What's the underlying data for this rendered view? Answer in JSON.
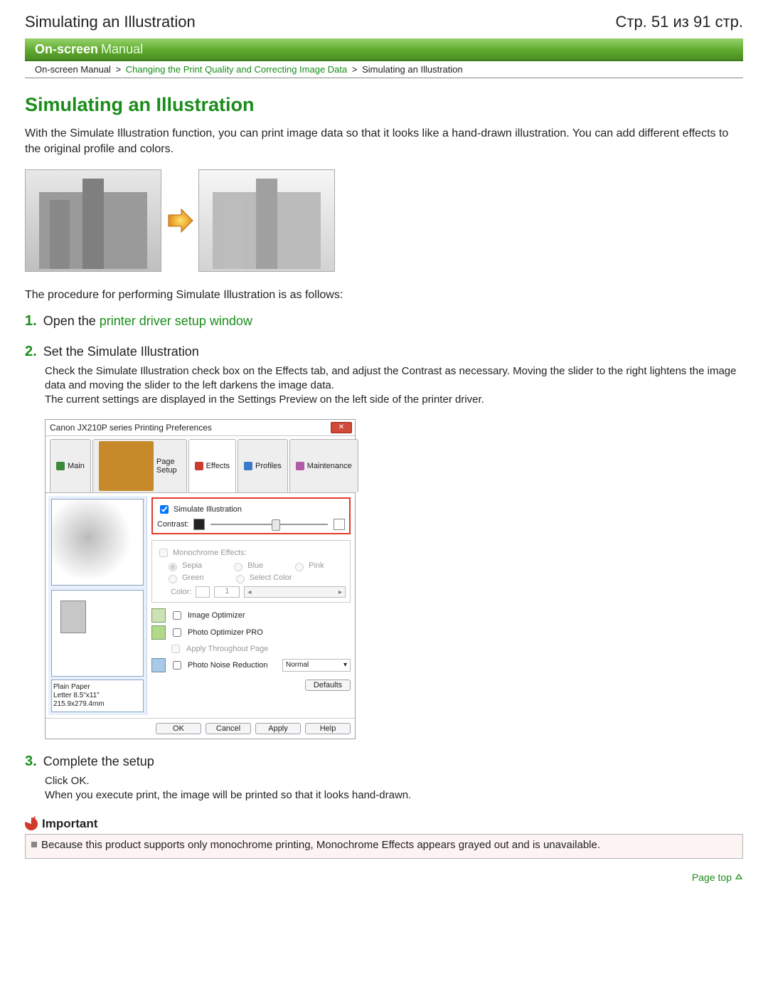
{
  "header": {
    "doc_title": "Simulating an Illustration",
    "page_indicator": "Стр. 51 из 91 стр."
  },
  "banner": {
    "bold": "On-screen",
    "light": "Manual"
  },
  "breadcrumb": {
    "root": "On-screen Manual",
    "mid": "Changing the Print Quality and Correcting Image Data",
    "leaf": "Simulating an Illustration",
    "sep": ">"
  },
  "title": "Simulating an Illustration",
  "intro": "With the Simulate Illustration function, you can print image data so that it looks like a hand-drawn illustration. You can add different effects to the original profile and colors.",
  "procedure_lead": "The procedure for performing Simulate Illustration is as follows:",
  "steps": {
    "s1": {
      "num": "1.",
      "pre": "Open the ",
      "link": "printer driver setup window"
    },
    "s2": {
      "num": "2.",
      "title": "Set the Simulate Illustration",
      "p1": "Check the Simulate Illustration check box on the Effects tab, and adjust the Contrast as necessary. Moving the slider to the right lightens the image data and moving the slider to the left darkens the image data.",
      "p2": "The current settings are displayed in the Settings Preview on the left side of the printer driver."
    },
    "s3": {
      "num": "3.",
      "title": "Complete the setup",
      "p1": "Click OK.",
      "p2": "When you execute print, the image will be printed so that it looks hand-drawn."
    }
  },
  "dialog": {
    "title": "Canon JX210P series Printing Preferences",
    "tabs": {
      "main": "Main",
      "page": "Page Setup",
      "effects": "Effects",
      "profiles": "Profiles",
      "maint": "Maintenance"
    },
    "left": {
      "paper_type": "Plain Paper",
      "paper_size": "Letter 8.5\"x11\" 215.9x279.4mm"
    },
    "sim": {
      "label": "Simulate Illustration",
      "contrast": "Contrast:"
    },
    "mono": {
      "group": "Monochrome Effects:",
      "sepia": "Sepia",
      "blue": "Blue",
      "pink": "Pink",
      "green": "Green",
      "select": "Select Color",
      "color_lbl": "Color:",
      "num": "1"
    },
    "opt": {
      "img": "Image Optimizer",
      "pro": "Photo Optimizer PRO",
      "apply": "Apply Throughout Page",
      "noise": "Photo Noise Reduction",
      "noise_val": "Normal"
    },
    "defaults": "Defaults",
    "buttons": {
      "ok": "OK",
      "cancel": "Cancel",
      "apply": "Apply",
      "help": "Help"
    },
    "scroll_left": "◄",
    "scroll_right": "►",
    "dropdown": "▾",
    "close": "✕"
  },
  "important": {
    "heading": "Important",
    "text": "Because this product supports only monochrome printing, Monochrome Effects appears grayed out and is unavailable."
  },
  "page_top": "Page top"
}
